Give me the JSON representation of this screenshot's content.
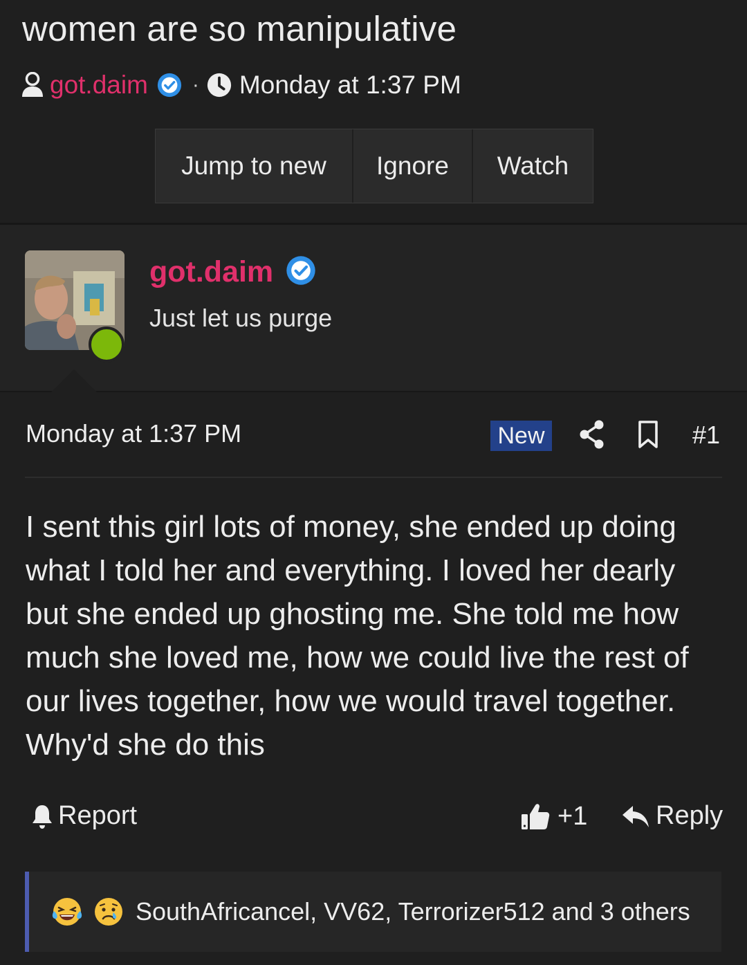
{
  "thread": {
    "title": "women are so manipulative",
    "author": "got.daim",
    "date": "Monday at 1:37 PM",
    "separator": "·"
  },
  "actions": {
    "jump_label": "Jump to new",
    "ignore_label": "Ignore",
    "watch_label": "Watch"
  },
  "post": {
    "author": "got.daim",
    "user_title": "Just let us purge",
    "date": "Monday at 1:37 PM",
    "badge": "New",
    "number": "#1",
    "body": "I sent this girl lots of money, she ended up doing what I told her and everything. I loved her dearly but she ended up ghosting me. She told me how much she loved me, how we could live the rest of our lives together, how we would travel together. Why'd she do this",
    "report_label": "Report",
    "like_count": "+1",
    "reply_label": "Reply",
    "reactions_text": "SouthAfricancel, VV62, Terrorizer512 and 3 others"
  },
  "icons": {
    "user": "user-icon",
    "verified": "verified-badge-icon",
    "clock": "clock-icon",
    "share": "share-icon",
    "bookmark": "bookmark-icon",
    "bell": "bell-icon",
    "thumb": "thumbs-up-icon",
    "reply": "reply-arrow-icon",
    "reaction_1": "laughing-tears-emoji",
    "reaction_2": "crying-face-emoji"
  },
  "colors": {
    "background": "#1f1f1f",
    "author_accent": "#e0306b",
    "verified_blue": "#2f8fe6",
    "new_badge": "#23418a",
    "online": "#7cb80a",
    "reaction_border": "#4d5cb0"
  }
}
